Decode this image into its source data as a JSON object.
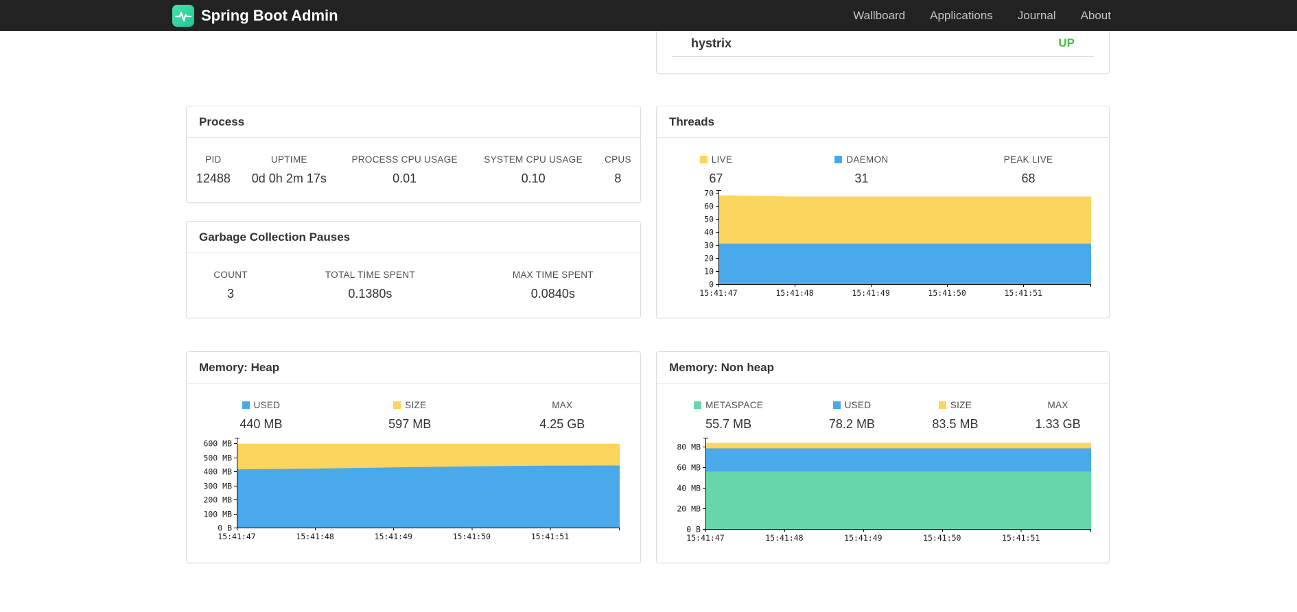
{
  "navbar": {
    "brand": "Spring Boot Admin",
    "links": [
      {
        "label": "Wallboard"
      },
      {
        "label": "Applications"
      },
      {
        "label": "Journal"
      },
      {
        "label": "About"
      }
    ]
  },
  "application": {
    "name": "hystrix",
    "status": "UP",
    "status_color": "#3dc03d"
  },
  "process": {
    "title": "Process",
    "stats": [
      {
        "label": "PID",
        "value": "12488"
      },
      {
        "label": "UPTIME",
        "value": "0d 0h 2m 17s"
      },
      {
        "label": "PROCESS CPU USAGE",
        "value": "0.01"
      },
      {
        "label": "SYSTEM CPU USAGE",
        "value": "0.10"
      },
      {
        "label": "CPUS",
        "value": "8"
      }
    ]
  },
  "gc": {
    "title": "Garbage Collection Pauses",
    "stats": [
      {
        "label": "COUNT",
        "value": "3"
      },
      {
        "label": "TOTAL TIME SPENT",
        "value": "0.1380s"
      },
      {
        "label": "MAX TIME SPENT",
        "value": "0.0840s"
      }
    ]
  },
  "threads": {
    "title": "Threads",
    "stats": [
      {
        "label": "LIVE",
        "value": "67",
        "chip": "#fbd55d"
      },
      {
        "label": "DAEMON",
        "value": "31",
        "chip": "#4aa9ea"
      },
      {
        "label": "PEAK LIVE",
        "value": "68"
      }
    ]
  },
  "memory_heap": {
    "title": "Memory: Heap",
    "stats": [
      {
        "label": "USED",
        "value": "440 MB",
        "chip": "#4aa9ea"
      },
      {
        "label": "SIZE",
        "value": "597 MB",
        "chip": "#fbd55d"
      },
      {
        "label": "MAX",
        "value": "4.25 GB"
      }
    ]
  },
  "memory_nonheap": {
    "title": "Memory: Non heap",
    "stats": [
      {
        "label": "METASPACE",
        "value": "55.7 MB",
        "chip": "#65d7ab"
      },
      {
        "label": "USED",
        "value": "78.2 MB",
        "chip": "#4aa9ea"
      },
      {
        "label": "SIZE",
        "value": "83.5 MB",
        "chip": "#fbd55d"
      },
      {
        "label": "MAX",
        "value": "1.33 GB"
      }
    ]
  },
  "chart_data": [
    {
      "id": "threads",
      "type": "area",
      "stacked": true,
      "title": "Threads",
      "x_ticks": [
        "15:41:47",
        "15:41:48",
        "15:41:49",
        "15:41:50",
        "15:41:51"
      ],
      "ylim": [
        0,
        72
      ],
      "y_ticks": [
        {
          "v": 0,
          "label": "0"
        },
        {
          "v": 10,
          "label": "10"
        },
        {
          "v": 20,
          "label": "20"
        },
        {
          "v": 30,
          "label": "30"
        },
        {
          "v": 40,
          "label": "40"
        },
        {
          "v": 50,
          "label": "50"
        },
        {
          "v": 60,
          "label": "60"
        },
        {
          "v": 70,
          "label": "70"
        }
      ],
      "series": [
        {
          "name": "DAEMON",
          "color": "#4aa9ea",
          "values": [
            31,
            31,
            31,
            31,
            31,
            31
          ]
        },
        {
          "name": "LIVE",
          "color": "#fbd55d",
          "values": [
            68,
            67,
            67,
            67,
            67,
            67
          ]
        }
      ]
    },
    {
      "id": "heap",
      "type": "area",
      "stacked": true,
      "title": "Memory: Heap",
      "x_ticks": [
        "15:41:47",
        "15:41:48",
        "15:41:49",
        "15:41:50",
        "15:41:51"
      ],
      "ylim": [
        0,
        640
      ],
      "y_ticks": [
        {
          "v": 0,
          "label": "0 B"
        },
        {
          "v": 100,
          "label": "100 MB"
        },
        {
          "v": 200,
          "label": "200 MB"
        },
        {
          "v": 300,
          "label": "300 MB"
        },
        {
          "v": 400,
          "label": "400 MB"
        },
        {
          "v": 500,
          "label": "500 MB"
        },
        {
          "v": 600,
          "label": "600 MB"
        }
      ],
      "series": [
        {
          "name": "USED",
          "color": "#4aa9ea",
          "values": [
            415,
            420,
            428,
            436,
            441,
            442
          ]
        },
        {
          "name": "SIZE",
          "color": "#fbd55d",
          "values": [
            597,
            597,
            597,
            597,
            597,
            597
          ]
        }
      ]
    },
    {
      "id": "nonheap",
      "type": "area",
      "stacked": true,
      "title": "Memory: Non heap",
      "x_ticks": [
        "15:41:47",
        "15:41:48",
        "15:41:49",
        "15:41:50",
        "15:41:51"
      ],
      "ylim": [
        0,
        88.5
      ],
      "y_ticks": [
        {
          "v": 0,
          "label": "0 B"
        },
        {
          "v": 20,
          "label": "20 MB"
        },
        {
          "v": 40,
          "label": "40 MB"
        },
        {
          "v": 60,
          "label": "60 MB"
        },
        {
          "v": 80,
          "label": "80 MB"
        }
      ],
      "series": [
        {
          "name": "METASPACE",
          "color": "#65d7ab",
          "values": [
            55.7,
            55.7,
            55.7,
            55.7,
            55.7,
            55.7
          ]
        },
        {
          "name": "USED",
          "color": "#4aa9ea",
          "values": [
            78.2,
            78.2,
            78.2,
            78.2,
            78.2,
            78.2
          ]
        },
        {
          "name": "SIZE",
          "color": "#fbd55d",
          "values": [
            83.5,
            83.5,
            83.5,
            83.5,
            83.5,
            83.5
          ]
        }
      ]
    }
  ]
}
